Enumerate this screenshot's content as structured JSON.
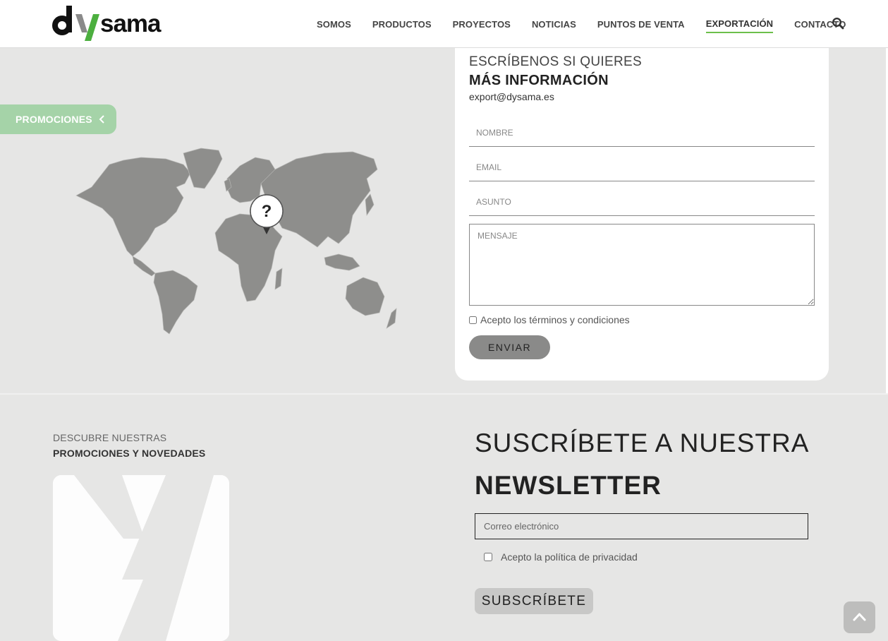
{
  "header": {
    "logo_text": "dysama",
    "nav": [
      {
        "label": "SOMOS"
      },
      {
        "label": "PRODUCTOS"
      },
      {
        "label": "PROYECTOS"
      },
      {
        "label": "NOTICIAS"
      },
      {
        "label": "PUNTOS DE VENTA"
      },
      {
        "label": "EXPORTACIÓN",
        "active": true
      },
      {
        "label": "CONTACTO"
      }
    ],
    "search_icon": "search-icon"
  },
  "promo_tab": {
    "label": "PROMOCIONES",
    "icon": "chevron-left-icon"
  },
  "map": {
    "marker_text": "?"
  },
  "form": {
    "subtitle": "ESCRÍBENOS SI QUIERES",
    "title": "MÁS INFORMACIÓN",
    "email": "export@dysama.es",
    "name_placeholder": "NOMBRE",
    "email_placeholder": "EMAIL",
    "subject_placeholder": "ASUNTO",
    "message_placeholder": "MENSAJE",
    "terms_label": "Acepto los términos y condiciones",
    "submit_label": "ENVIAR"
  },
  "promotions": {
    "subtitle": "DESCUBRE NUESTRAS",
    "title": "PROMOCIONES Y NOVEDADES"
  },
  "newsletter": {
    "line1": "SUSCRÍBETE A NUESTRA",
    "line2": "NEWSLETTER",
    "email_placeholder": "Correo electrónico",
    "privacy_label": "Acepto la política de privacidad",
    "submit_label": "SUBSCRÍBETE"
  },
  "scroll_top_icon": "chevron-up-icon",
  "colors": {
    "brand_green": "#6cbf4b",
    "promo_tab": "#a5d3a8",
    "background": "#e6e6e5"
  }
}
